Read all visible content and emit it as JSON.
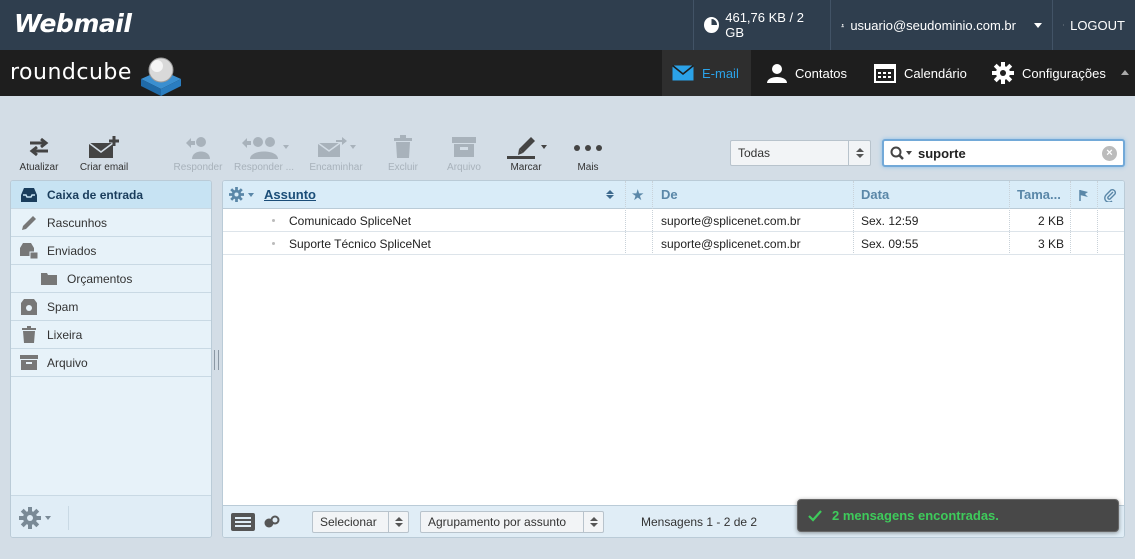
{
  "topbar": {
    "brand": "Webmail",
    "quota": "461,76 KB / 2 GB",
    "user": "usuario@seudominio.com.br",
    "logout": "LOGOUT"
  },
  "header": {
    "logo": "roundcube",
    "nav": [
      {
        "label": "E-mail",
        "icon": "mail-icon",
        "selected": true
      },
      {
        "label": "Contatos",
        "icon": "contacts-icon"
      },
      {
        "label": "Calendário",
        "icon": "calendar-icon"
      },
      {
        "label": "Configurações",
        "icon": "gear-icon"
      }
    ]
  },
  "toolbar": {
    "refresh": "Atualizar",
    "compose": "Criar email",
    "reply": "Responder",
    "reply_all": "Responder ...",
    "forward": "Encaminhar",
    "delete": "Excluir",
    "archive": "Arquivo",
    "mark": "Marcar",
    "more": "Mais"
  },
  "filter": {
    "selected": "Todas"
  },
  "search": {
    "value": "suporte"
  },
  "folders": [
    {
      "label": "Caixa de entrada",
      "icon": "inbox-icon",
      "selected": true
    },
    {
      "label": "Rascunhos",
      "icon": "pencil-icon"
    },
    {
      "label": "Enviados",
      "icon": "sent-icon"
    },
    {
      "label": "Orçamentos",
      "icon": "folder-icon",
      "sub": true
    },
    {
      "label": "Spam",
      "icon": "spam-icon"
    },
    {
      "label": "Lixeira",
      "icon": "trash-icon"
    },
    {
      "label": "Arquivo",
      "icon": "archive-icon"
    }
  ],
  "list": {
    "columns": {
      "subject": "Assunto",
      "from": "De",
      "date": "Data",
      "size": "Tama..."
    },
    "rows": [
      {
        "subject": "Comunicado SpliceNet",
        "from": "suporte@splicenet.com.br",
        "date": "Sex. 12:59",
        "size": "2 KB"
      },
      {
        "subject": "Suporte Técnico SpliceNet",
        "from": "suporte@splicenet.com.br",
        "date": "Sex. 09:55",
        "size": "3 KB"
      }
    ],
    "footer": {
      "select": "Selecionar",
      "threads": "Agrupamento por assunto",
      "count": "Mensagens 1 - 2 de 2"
    }
  },
  "notification": "2 mensagens encontradas.",
  "colors": {
    "topbar": "#2f3e4e",
    "header": "#1e1e1e",
    "accent": "#2ba2e8",
    "notify": "#3ecb5b"
  }
}
